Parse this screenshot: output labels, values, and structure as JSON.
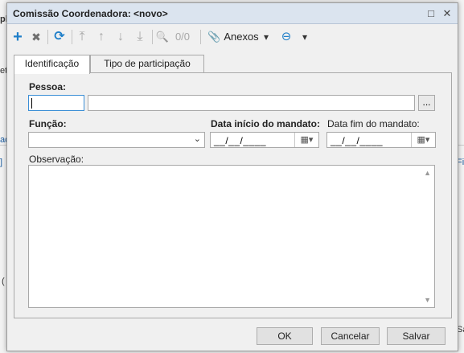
{
  "background": {
    "frag_a": "pl",
    "frag_b": "et",
    "frag_c": "ac",
    "frag_d": "]",
    "frag_e": "(",
    "frag_f": "Fin",
    "frag_g": "Sa"
  },
  "dialog": {
    "title": "Comissão Coordenadora: <novo>",
    "maximize_glyph": "□",
    "close_glyph": "✕"
  },
  "toolbar": {
    "add_glyph": "+",
    "delete_glyph": "✖",
    "refresh_glyph": "⟳",
    "first_glyph": "⤒",
    "up_glyph": "↑",
    "down_glyph": "↓",
    "last_glyph": "⤓",
    "search_glyph": "🔍",
    "record_counter": "0/0",
    "attach_glyph": "📎",
    "attachments_label": "Anexos",
    "dropdown_glyph": "▾",
    "other_glyph": "⊖",
    "other_dropdown_glyph": "▾"
  },
  "tabs": [
    {
      "label": "Identificação",
      "active": true
    },
    {
      "label": "Tipo de participação",
      "active": false
    }
  ],
  "form": {
    "pessoa_label": "Pessoa:",
    "pessoa_code_value": "",
    "pessoa_name_value": "",
    "browse_label": "...",
    "funcao_label": "Função:",
    "funcao_value": "",
    "data_inicio_label": "Data início do mandato:",
    "data_inicio_value": "__/__/____",
    "data_fim_label": "Data fim do mandato:",
    "data_fim_value": "__/__/____",
    "calendar_glyph": "▦▾",
    "observacao_label": "Observação:",
    "observacao_value": ""
  },
  "footer": {
    "ok_label": "OK",
    "cancel_label": "Cancelar",
    "save_label": "Salvar"
  }
}
